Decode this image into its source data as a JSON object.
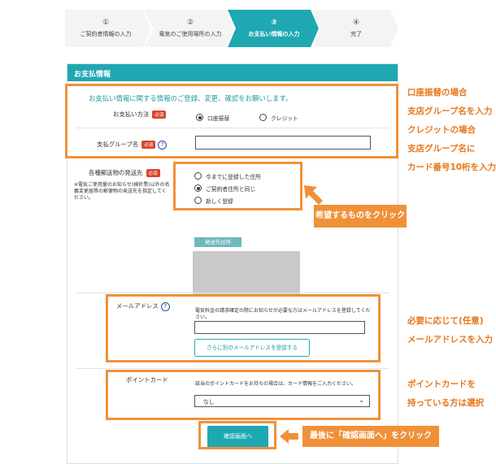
{
  "steps": [
    {
      "num": "①",
      "label": "ご契約者情報の入力"
    },
    {
      "num": "②",
      "label": "電気のご使用場所の入力"
    },
    {
      "num": "③",
      "label": "お支払い情報の入力"
    },
    {
      "num": "④",
      "label": "完了"
    }
  ],
  "active_step": 3,
  "panel": {
    "title": "お支払情報",
    "intro": "お支払い情報に関する情報のご登録、変更、確認をお願いします。",
    "required_badge": "必須",
    "help_glyph": "?",
    "payment_method": {
      "label": "お支払い方法",
      "options": [
        "口座振替",
        "クレジット"
      ],
      "selected": "口座振替"
    },
    "payment_group": {
      "label": "支払グループ名",
      "value": ""
    },
    "shipping": {
      "label": "各種郵送物の発送先",
      "note": "※電気ご使用量のお知らせ(検針票)以外の名義変更届等の郵便物の発送先を指定してください。",
      "options": [
        "今までに登録した住所",
        "ご契約者住所と同じ",
        "新しく登録"
      ],
      "selected": "ご契約者住所と同じ"
    },
    "address_label": "発送先住所",
    "email": {
      "label": "メールアドレス",
      "hint": "電気料金の請求確定の際にお知らせが必要な方はメールアドレスを登録してください。",
      "value": "",
      "add_button": "さらに別のメールアドレスを登録する"
    },
    "point_card": {
      "label": "ポイントカード",
      "hint": "該当のポイントカードをお持ちの場合は、カード情報をご入力ください。",
      "selected": "なし"
    },
    "confirm_button": "確認画面へ"
  },
  "annotations": {
    "payment_right": [
      "口座振替の場合",
      "支店グループ名を入力",
      "クレジットの場合",
      "支店グループ名に",
      "カード番号10桁を入力"
    ],
    "shipping_callout": "希望するものをクリック",
    "email_right": [
      "必要に応じて(任意)",
      "メールアドレスを入力"
    ],
    "point_right": [
      "ポイントカードを",
      "持っている方は選択"
    ],
    "confirm_callout": "最後に「確認画面へ」をクリック"
  },
  "colors": {
    "accent": "#20a8b2",
    "annotation": "#f0913a",
    "required": "#d9452b"
  }
}
